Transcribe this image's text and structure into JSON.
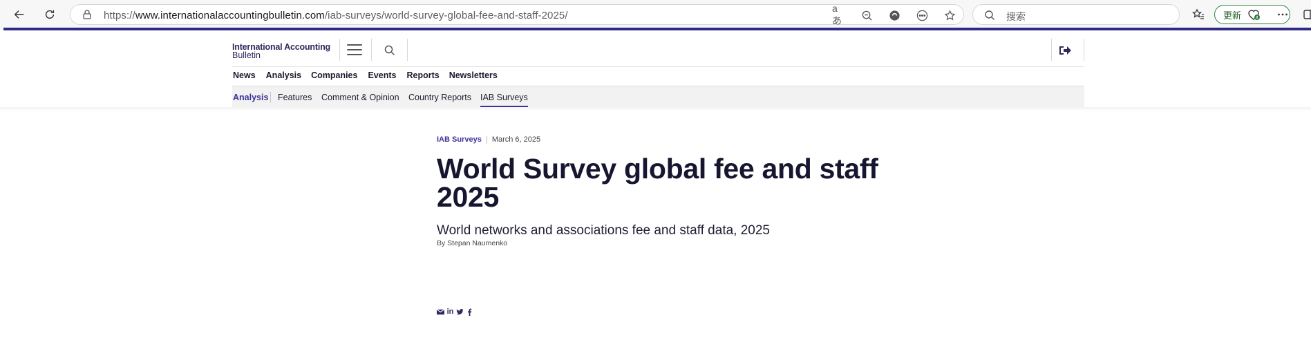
{
  "browser": {
    "url_prefix": "https://",
    "url_host": "www.internationalaccountingbulletin.com",
    "url_path": "/iab-surveys/world-survey-global-fee-and-staff-2025/",
    "search_placeholder": "搜索",
    "update_label": "更新",
    "read_aloud_glyph": "aあ"
  },
  "site": {
    "logo_line1": "International Accounting",
    "logo_line2": "Bulletin"
  },
  "main_nav": [
    {
      "label": "News"
    },
    {
      "label": "Analysis"
    },
    {
      "label": "Companies"
    },
    {
      "label": "Events"
    },
    {
      "label": "Reports"
    },
    {
      "label": "Newsletters"
    }
  ],
  "sub_nav": {
    "section": "Analysis",
    "items": [
      {
        "label": "Features"
      },
      {
        "label": "Comment & Opinion"
      },
      {
        "label": "Country Reports"
      },
      {
        "label": "IAB Surveys"
      }
    ]
  },
  "article": {
    "category": "IAB Surveys",
    "date": "March 6, 2025",
    "title": "World Survey global fee and staff 2025",
    "subtitle": "World networks and associations fee and staff data, 2025",
    "byline": "By Stepan Naumenko"
  },
  "share": {
    "linkedin_glyph": "in"
  },
  "colors": {
    "brand": "#2f2a5c",
    "accent": "#3d3399",
    "browser_accent_bar": "#2f2a86",
    "update_border": "#2e8540"
  }
}
